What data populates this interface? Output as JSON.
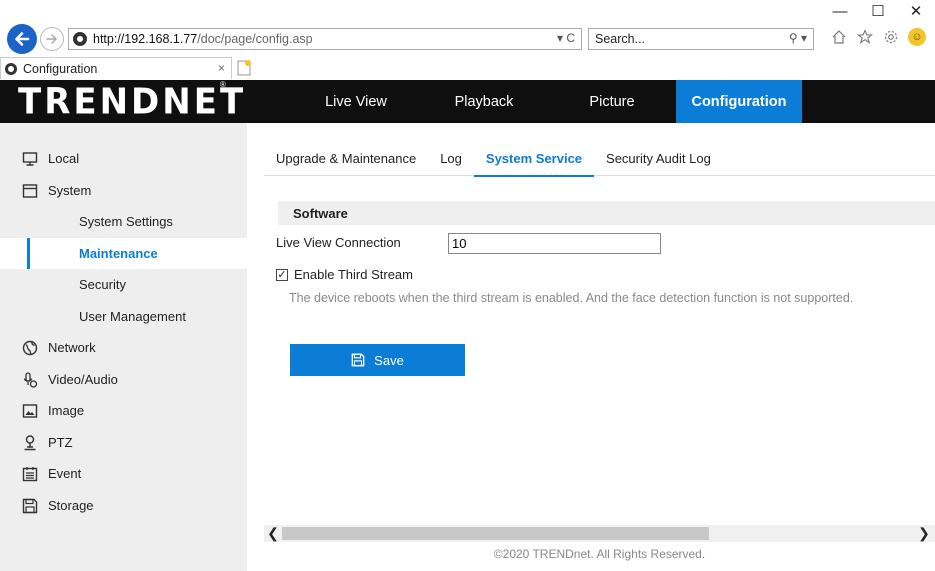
{
  "browser": {
    "window_controls": {
      "minimize": "—",
      "maximize": "☐",
      "close": "✕"
    },
    "address": {
      "host": "http://192.168.1.77",
      "path": "/doc/page/config.asp",
      "tools": "▾ C"
    },
    "search": {
      "placeholder": "Search...",
      "tools": "⚲ ▾"
    },
    "tab": {
      "title": "Configuration",
      "close": "×"
    }
  },
  "app": {
    "logo": "TRENDNET",
    "logo_reg": "®",
    "menu": [
      {
        "label": "Live View"
      },
      {
        "label": "Playback"
      },
      {
        "label": "Picture"
      },
      {
        "label": "Configuration",
        "active": true
      }
    ]
  },
  "sidebar": {
    "items": [
      {
        "label": "Local",
        "icon": "monitor-icon"
      },
      {
        "label": "System",
        "icon": "window-icon"
      },
      {
        "label": "System Settings",
        "sub": true
      },
      {
        "label": "Maintenance",
        "sub": true,
        "active": true
      },
      {
        "label": "Security",
        "sub": true
      },
      {
        "label": "User Management",
        "sub": true
      },
      {
        "label": "Network",
        "icon": "globe-icon"
      },
      {
        "label": "Video/Audio",
        "icon": "microphone-icon"
      },
      {
        "label": "Image",
        "icon": "image-icon"
      },
      {
        "label": "PTZ",
        "icon": "ptz-icon"
      },
      {
        "label": "Event",
        "icon": "calendar-icon"
      },
      {
        "label": "Storage",
        "icon": "save-icon"
      }
    ]
  },
  "main": {
    "subtabs": [
      {
        "label": "Upgrade & Maintenance"
      },
      {
        "label": "Log"
      },
      {
        "label": "System Service",
        "active": true
      },
      {
        "label": "Security Audit Log"
      }
    ],
    "section_title": "Software",
    "live_view_connection_label": "Live View Connection",
    "live_view_connection_value": "10",
    "third_stream_label": "Enable Third Stream",
    "third_stream_checked": true,
    "note": "The device reboots when the third stream is enabled. And the face detection function is not supported.",
    "save_label": "Save",
    "footer": "©2020 TRENDnet. All Rights Reserved."
  },
  "colors": {
    "accent": "#0b7dd6",
    "header_bg": "#0f0f0f",
    "sidebar_bg": "#eeeeee"
  }
}
